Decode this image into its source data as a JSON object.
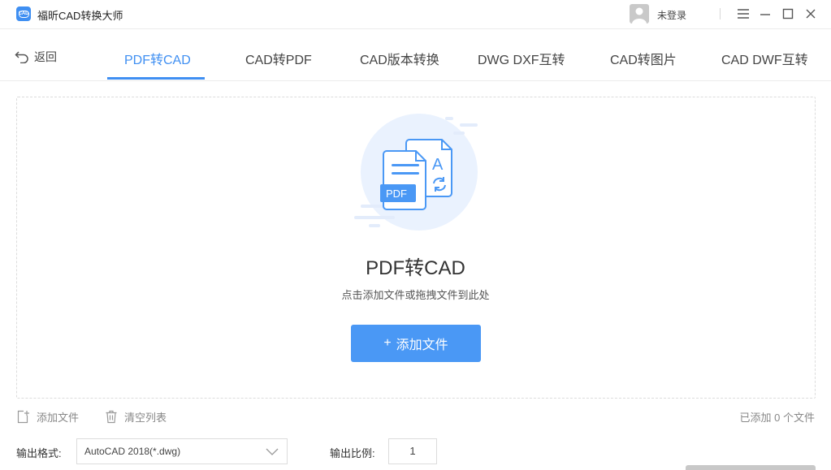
{
  "app": {
    "title": "福昕CAD转换大师",
    "logo_text": "CAD"
  },
  "header": {
    "login": "未登录"
  },
  "nav": {
    "back": "返回",
    "tabs": [
      {
        "label": "PDF转CAD",
        "active": true
      },
      {
        "label": "CAD转PDF"
      },
      {
        "label": "CAD版本转换"
      },
      {
        "label": "DWG DXF互转"
      },
      {
        "label": "CAD转图片"
      },
      {
        "label": "CAD DWF互转"
      }
    ]
  },
  "dropzone": {
    "illustration": {
      "pdf_label": "PDF",
      "letter": "A"
    },
    "title": "PDF转CAD",
    "subtitle": "点击添加文件或拖拽文件到此处",
    "add_button": "添加文件",
    "add_button_prefix": "+"
  },
  "toolbar": {
    "add_file": "添加文件",
    "clear_list": "清空列表",
    "count": "已添加 0 个文件"
  },
  "output": {
    "format_label": "输出格式:",
    "format_value": "AutoCAD 2018(*.dwg)",
    "scale_label": "输出比例:",
    "scale_value": "1"
  },
  "colors": {
    "accent": "#3f8ff2",
    "button": "#4a98f5"
  }
}
